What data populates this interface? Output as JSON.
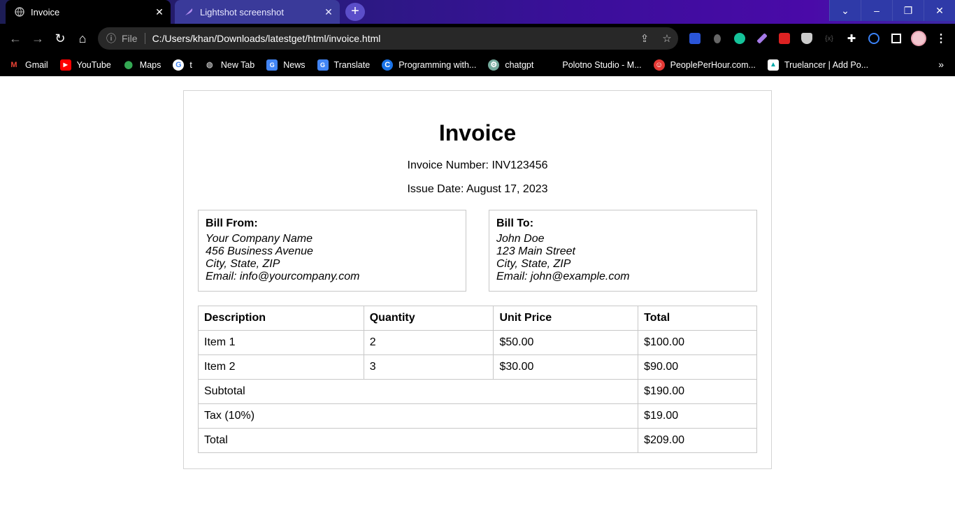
{
  "browser": {
    "tabs": [
      {
        "title": "Invoice",
        "active": true
      },
      {
        "title": "Lightshot screenshot",
        "active": false
      }
    ],
    "address": {
      "scheme_label": "File",
      "url": "C:/Users/khan/Downloads/latestget/html/invoice.html"
    },
    "bookmarks": [
      {
        "label": "Gmail",
        "icon": "gmail-icon"
      },
      {
        "label": "YouTube",
        "icon": "youtube-icon"
      },
      {
        "label": "Maps",
        "icon": "maps-icon"
      },
      {
        "label": "t",
        "icon": "google-icon"
      },
      {
        "label": "New Tab",
        "icon": "globe-icon"
      },
      {
        "label": "News",
        "icon": "news-icon"
      },
      {
        "label": "Translate",
        "icon": "translate-icon"
      },
      {
        "label": "Programming with...",
        "icon": "c-icon"
      },
      {
        "label": "chatgpt",
        "icon": "chatgpt-icon"
      },
      {
        "label": "Polotno Studio - M...",
        "icon": "blank-icon"
      },
      {
        "label": "PeoplePerHour.com...",
        "icon": "pph-icon"
      },
      {
        "label": "Truelancer | Add Po...",
        "icon": "truelancer-icon"
      }
    ],
    "colors": {
      "accent": "#5b4ec9",
      "tabstrip_gradient": [
        "#1d1d55",
        "#4a0aa8"
      ]
    }
  },
  "invoice": {
    "title": "Invoice",
    "number_line": "Invoice Number: INV123456",
    "date_line": "Issue Date: August 17, 2023",
    "bill_from": {
      "heading": "Bill From:",
      "lines": [
        "Your Company Name",
        "456 Business Avenue",
        "City, State, ZIP",
        "Email: info@yourcompany.com"
      ]
    },
    "bill_to": {
      "heading": "Bill To:",
      "lines": [
        "John Doe",
        "123 Main Street",
        "City, State, ZIP",
        "Email: john@example.com"
      ]
    },
    "table": {
      "headers": [
        "Description",
        "Quantity",
        "Unit Price",
        "Total"
      ],
      "rows": [
        [
          "Item 1",
          "2",
          "$50.00",
          "$100.00"
        ],
        [
          "Item 2",
          "3",
          "$30.00",
          "$90.00"
        ]
      ],
      "summary": [
        {
          "label": "Subtotal",
          "value": "$190.00"
        },
        {
          "label": "Tax (10%)",
          "value": "$19.00"
        },
        {
          "label": "Total",
          "value": "$209.00"
        }
      ]
    }
  }
}
